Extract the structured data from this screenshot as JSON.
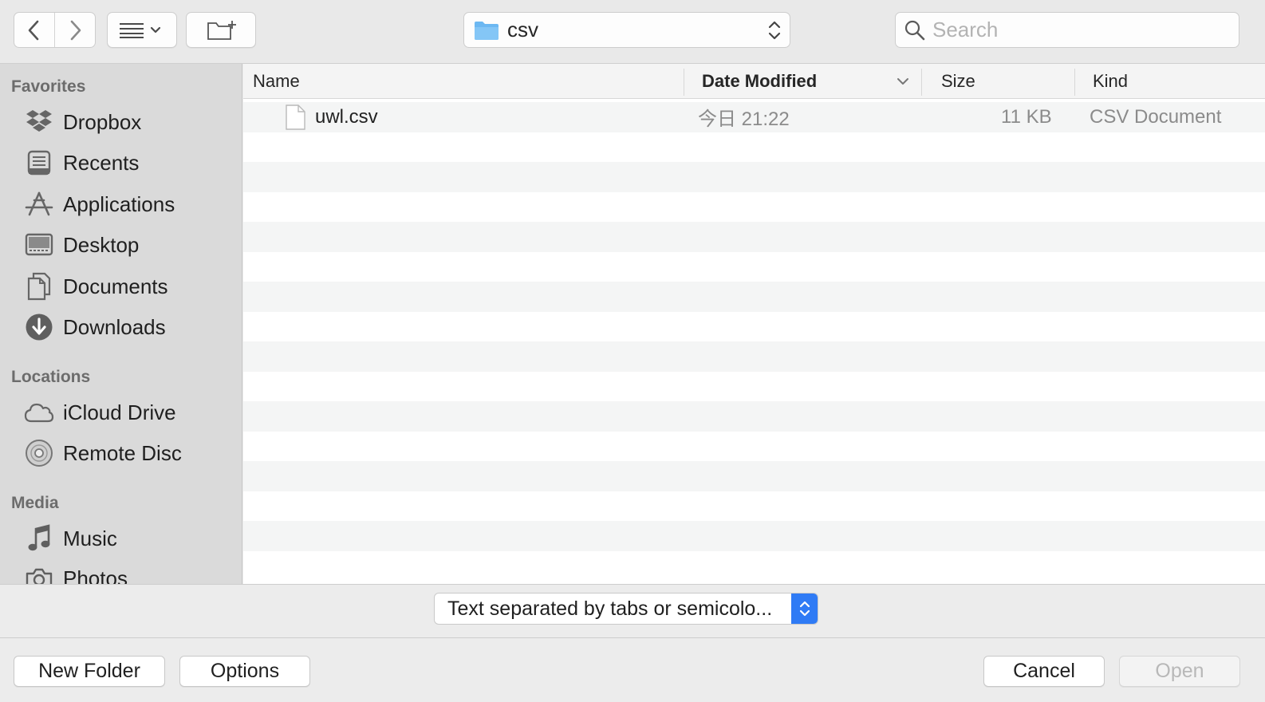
{
  "toolbar": {
    "path_label": "csv",
    "search_placeholder": "Search"
  },
  "sidebar": {
    "sections": [
      {
        "title": "Favorites",
        "items": [
          "Dropbox",
          "Recents",
          "Applications",
          "Desktop",
          "Documents",
          "Downloads"
        ]
      },
      {
        "title": "Locations",
        "items": [
          "iCloud Drive",
          "Remote Disc"
        ]
      },
      {
        "title": "Media",
        "items": [
          "Music",
          "Photos"
        ]
      }
    ]
  },
  "filelist": {
    "columns": {
      "name": "Name",
      "date": "Date Modified",
      "size": "Size",
      "kind": "Kind"
    },
    "files": [
      {
        "name": "uwl.csv",
        "date": "今日 21:22",
        "size": "11 KB",
        "kind": "CSV Document"
      }
    ]
  },
  "format": {
    "selected": "Text separated by tabs or semicolo..."
  },
  "buttons": {
    "new_folder": "New Folder",
    "options": "Options",
    "cancel": "Cancel",
    "open": "Open"
  },
  "colors": {
    "accent": "#2f7bf5",
    "folder": "#6cb8f2"
  }
}
